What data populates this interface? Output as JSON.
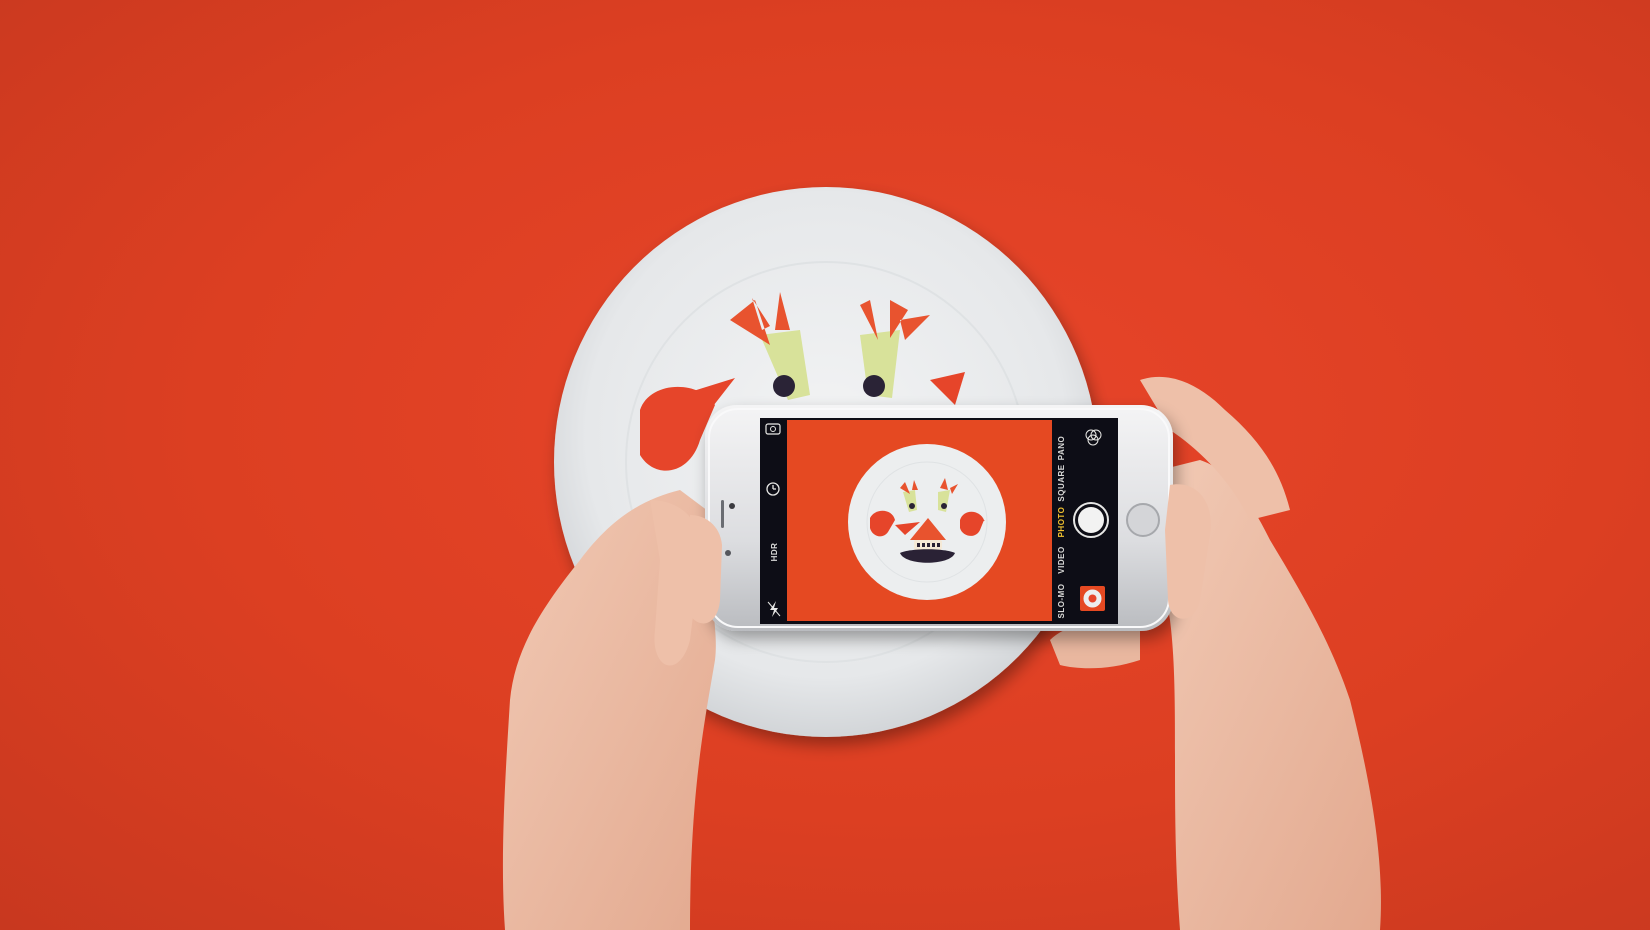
{
  "scene": {
    "background_color": "#dc3f22",
    "plate_color": "#e9ebed",
    "subject": "food-art-crab-on-plate"
  },
  "camera_app": {
    "top_bar": {
      "flash_icon": "flash-off-icon",
      "hdr_label": "HDR",
      "timer_icon": "timer-icon",
      "switch_camera_icon": "camera-switch-icon"
    },
    "modes": [
      "SLO-MO",
      "VIDEO",
      "PHOTO",
      "SQUARE",
      "PANO"
    ],
    "active_mode": "PHOTO",
    "active_color": "#f2c230",
    "shutter_icon": "shutter-button",
    "filters_icon": "filters-icon",
    "thumbnail_icon": "last-photo-thumbnail"
  }
}
